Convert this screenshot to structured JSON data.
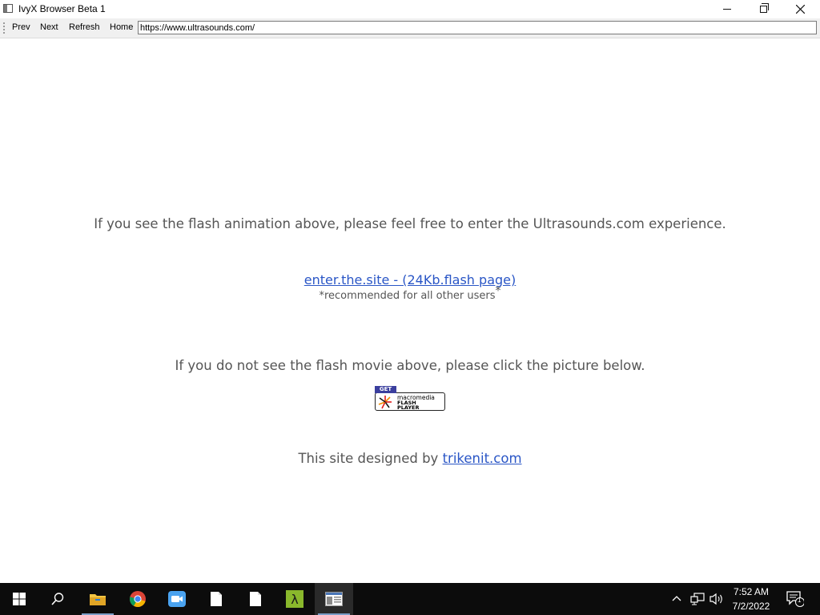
{
  "window": {
    "title": "IvyX Browser Beta 1",
    "controls": {
      "minimize_icon": "minimize-icon",
      "maximize_icon": "restore-icon",
      "close_icon": "close-icon"
    }
  },
  "toolbar": {
    "prev_label": "Prev",
    "next_label": "Next",
    "refresh_label": "Refresh",
    "home_label": "Home",
    "url": "https://www.ultrasounds.com/"
  },
  "page": {
    "intro_text": "If you see the flash animation above, please feel free to enter the Ultrasounds.com experience.",
    "enter_link": "enter.the.site - (24Kb.flash page)",
    "recommend_text": "*recommended for all other users",
    "recommend_star": "*",
    "no_flash_text": "If you do not see the flash movie above, please click the picture below.",
    "flash_badge": {
      "get": "GET",
      "line1": "macromedia",
      "line2": "FLASH",
      "line3": "PLAYER"
    },
    "designed_text": "This site designed by ",
    "designed_link": "trikenit.com",
    "link_color": "#2a56c6",
    "text_color": "#555555"
  },
  "taskbar": {
    "items": [
      {
        "icon": "windows-start-icon"
      },
      {
        "icon": "search-icon"
      },
      {
        "icon": "file-explorer-icon"
      },
      {
        "icon": "chrome-icon"
      },
      {
        "icon": "zoom-icon"
      },
      {
        "icon": "document-icon"
      },
      {
        "icon": "document-icon"
      },
      {
        "icon": "lambda-app-icon"
      },
      {
        "icon": "browser-app-icon",
        "active": true
      }
    ],
    "clock_time": "7:52 AM",
    "clock_date": "7/2/2022",
    "notification_count": "1",
    "background": "#0c0c0c"
  }
}
